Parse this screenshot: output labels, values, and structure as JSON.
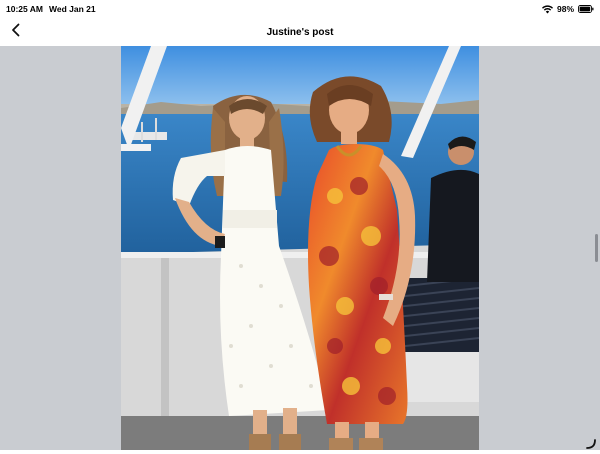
{
  "status": {
    "time": "10:25 AM",
    "date": "Wed Jan 21",
    "battery": "98%",
    "wifi_icon": "wifi-icon",
    "battery_icon": "battery-icon"
  },
  "nav": {
    "title": "Justine's post",
    "back_icon": "chevron-left-icon"
  },
  "photo": {
    "description_icon": "photo-image"
  },
  "colors": {
    "viewer_bg": "#c9ccd1",
    "sky": "#5aa6e6",
    "water": "#2f76b8"
  }
}
